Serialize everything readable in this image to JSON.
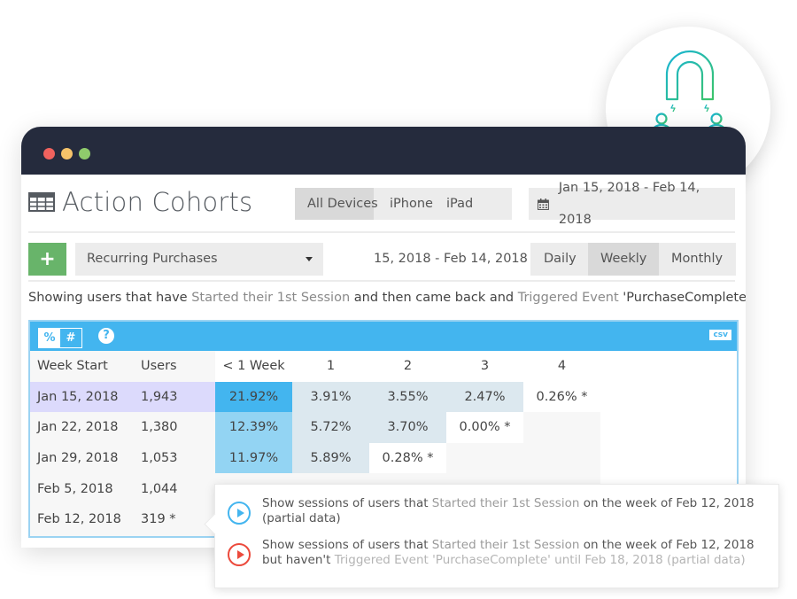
{
  "window": {
    "title": "Action Cohorts",
    "device_filter": {
      "options": [
        "All Devices",
        "iPhone",
        "iPad"
      ],
      "selected": "All Devices"
    },
    "date_range": "Jan 15, 2018 - Feb 14, 2018",
    "cohort_select": "Recurring Purchases",
    "sub_range": "15, 2018 - Feb 14, 2018",
    "period": {
      "options": [
        "Daily",
        "Weekly",
        "Monthly"
      ],
      "selected": "Weekly"
    },
    "description": {
      "p1": "Showing users that have ",
      "h1": "Started their 1st Session",
      "p2": " and then came back and ",
      "h2": "Triggered Event ",
      "p3": "'PurchaseComplete'"
    }
  },
  "table_toolbar": {
    "percent_label": "%",
    "number_label": "#",
    "help_label": "?",
    "csv_label": "csv"
  },
  "cohort_table": {
    "headers": [
      "Week Start",
      "Users",
      "< 1 Week",
      "1",
      "2",
      "3",
      "4"
    ],
    "rows": [
      {
        "week": "Jan 15, 2018",
        "users": "1,943",
        "values": [
          "21.92%",
          "3.91%",
          "3.55%",
          "2.47%",
          "0.26% *"
        ]
      },
      {
        "week": "Jan 22, 2018",
        "users": "1,380",
        "values": [
          "12.39%",
          "5.72%",
          "3.70%",
          "0.00% *"
        ]
      },
      {
        "week": "Jan 29, 2018",
        "users": "1,053",
        "values": [
          "11.97%",
          "5.89%",
          "0.28% *"
        ]
      },
      {
        "week": "Feb 5, 2018",
        "users": "1,044",
        "values": []
      },
      {
        "week": "Feb 12, 2018",
        "users": "319 *",
        "values": []
      }
    ],
    "cell_colors": {
      "strong": "#43b5ef",
      "medium": "#93d4f3",
      "light": "#dce8ef",
      "highlight_row": "#dcdafc"
    }
  },
  "tooltip": {
    "item1": {
      "p1": "Show sessions of users that ",
      "h1": "Started their 1st Session",
      "p2": " on the week of Feb 12, 2018 (partial data)"
    },
    "item2": {
      "p1": "Show sessions of users that ",
      "h1": "Started their 1st Session",
      "p2": " on the week of Feb 12, 2018 but haven't ",
      "h2": "Triggered Event 'PurchaseComplete' until Feb 18, 2018 (partial data)"
    }
  },
  "badge": {
    "icon": "magnet-attracting-users-icon",
    "gradient": [
      "#1bb7d6",
      "#3cc46a"
    ]
  }
}
